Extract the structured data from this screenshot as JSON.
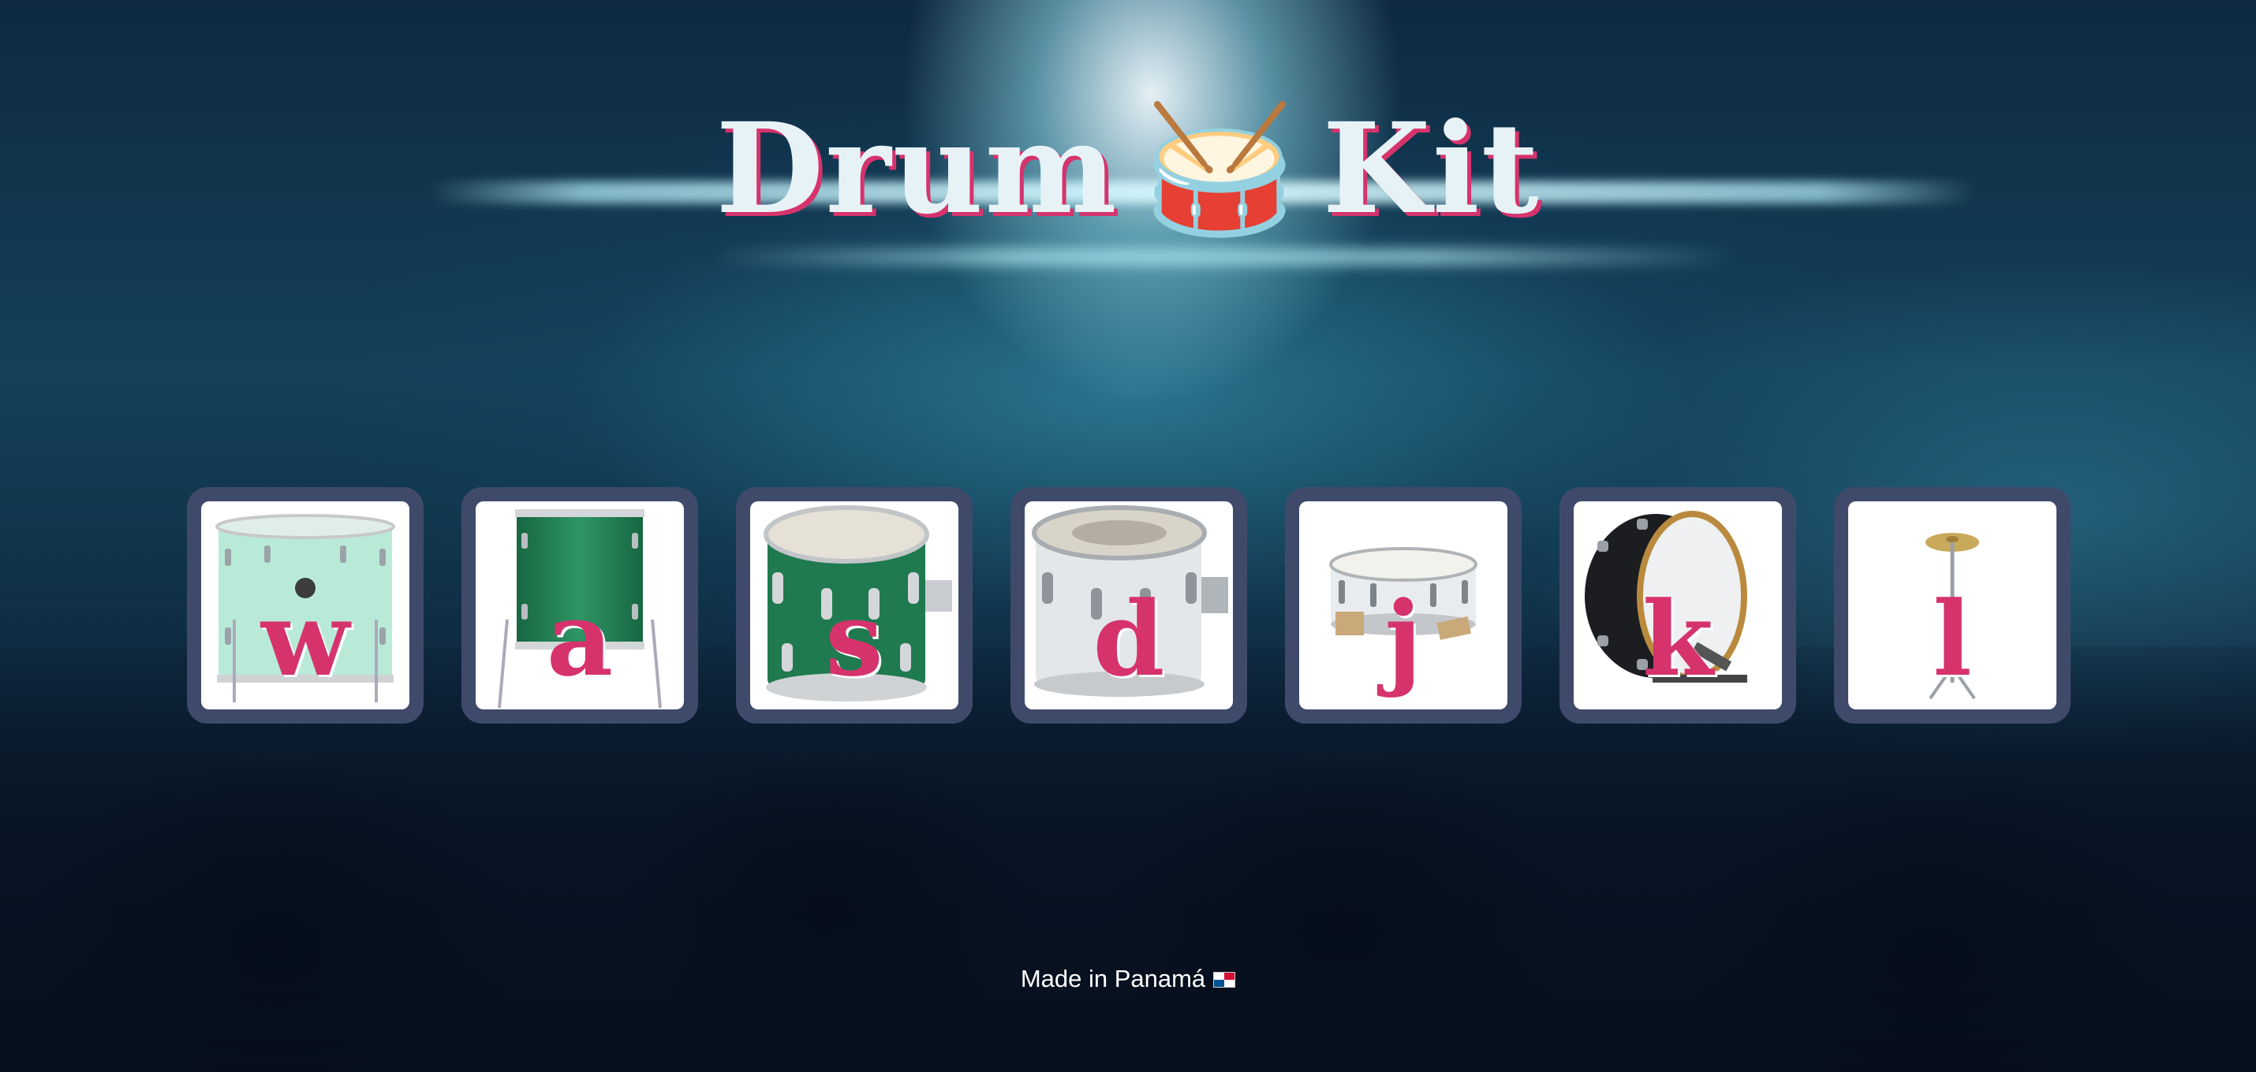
{
  "header": {
    "title_left": "Drum",
    "title_emoji": "🥁",
    "title_right": "Kit"
  },
  "keys": [
    {
      "letter": "w",
      "instrument_icon": "floor-tom-mint-icon"
    },
    {
      "letter": "a",
      "instrument_icon": "floor-tom-green-icon"
    },
    {
      "letter": "s",
      "instrument_icon": "rack-tom-green-icon"
    },
    {
      "letter": "d",
      "instrument_icon": "rack-tom-clear-icon"
    },
    {
      "letter": "j",
      "instrument_icon": "snare-drum-icon"
    },
    {
      "letter": "k",
      "instrument_icon": "bass-drum-icon"
    },
    {
      "letter": "l",
      "instrument_icon": "cymbal-icon"
    }
  ],
  "footer": {
    "text": "Made in Panamá",
    "flag_icon": "panama-flag-icon"
  },
  "colors": {
    "accent": "#d6336c",
    "key_border": "#3f4a6b",
    "title": "#e7f2f7"
  }
}
